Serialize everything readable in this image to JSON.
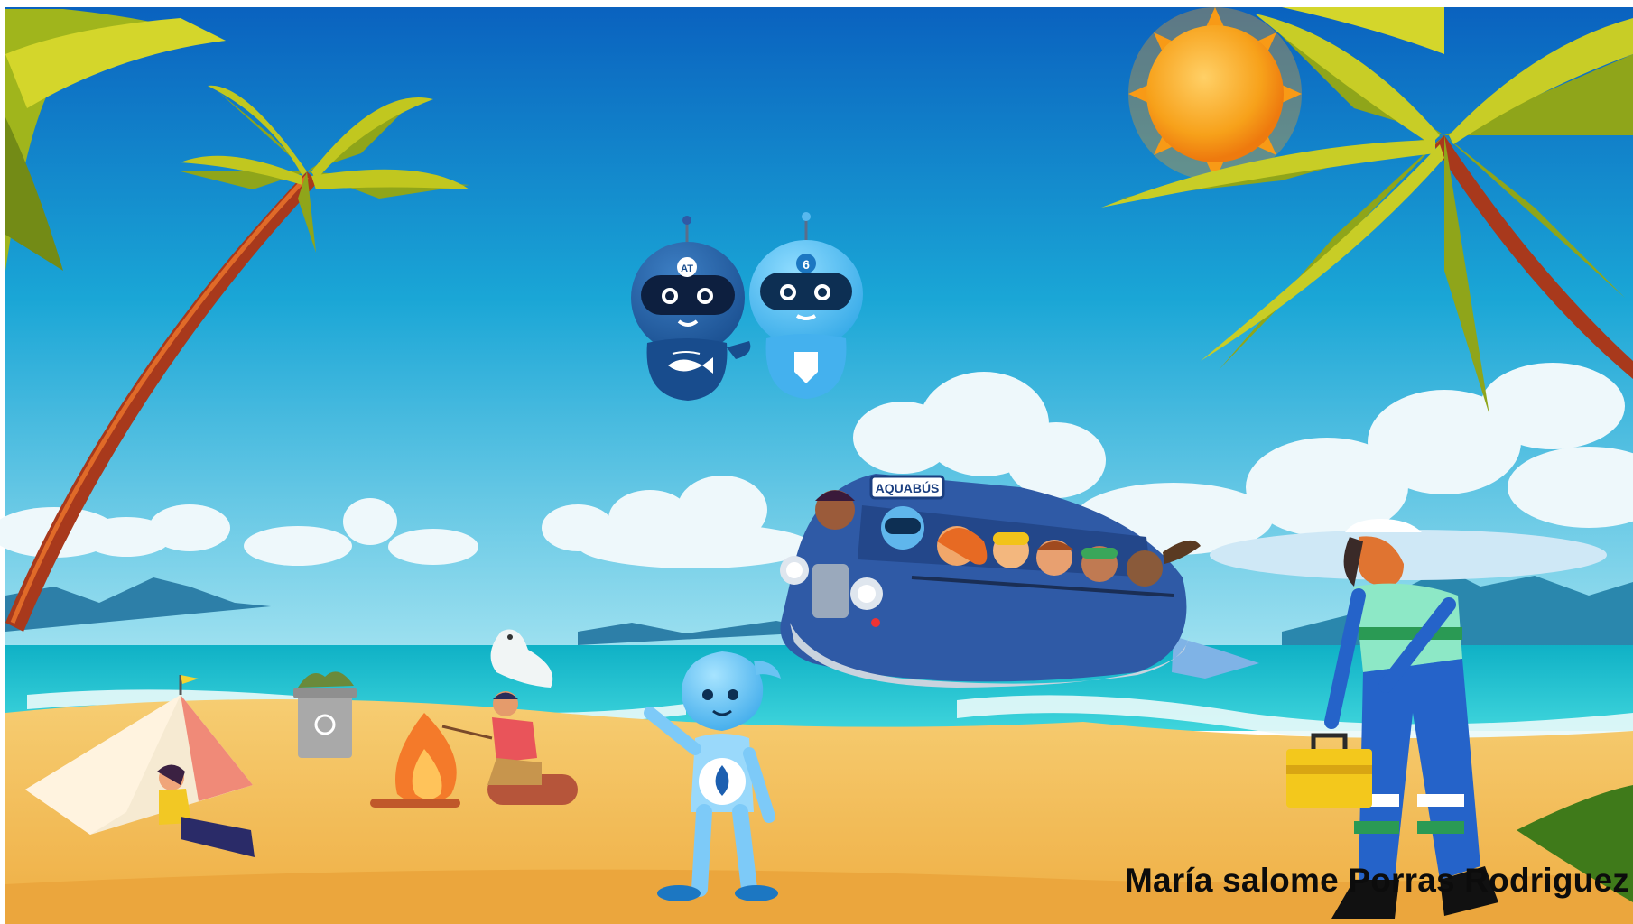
{
  "author_caption": "María salome Porras Rodriguez",
  "bus_sign": "AQUABÚS",
  "robot_left_badge": "AT",
  "robot_right_badge": "6",
  "colors": {
    "sky_top": "#0a6cc4",
    "sky_bottom": "#7fd3ea",
    "sea": "#16b7c9",
    "sand": "#f3bc56",
    "bus_blue": "#2f5aa6",
    "sun": "#f7a11a"
  },
  "icons": [
    "sun-icon",
    "palm-tree-icon",
    "cloud-icon",
    "robot-icon",
    "bus-icon",
    "tent-icon",
    "campfire-icon",
    "trash-bin-icon",
    "seal-icon",
    "water-drop-mascot-icon",
    "worker-icon",
    "toolbox-icon"
  ]
}
